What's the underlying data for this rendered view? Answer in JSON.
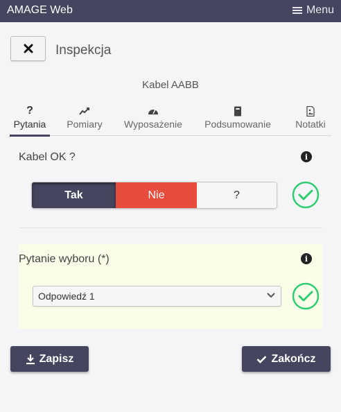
{
  "app": {
    "title": "AMAGE Web",
    "menu_label": "Menu"
  },
  "header": {
    "close_icon": "close-icon",
    "title": "Inspekcja"
  },
  "subject": "Kabel AABB",
  "tabs": [
    {
      "label": "Pytania",
      "icon": "question-icon",
      "active": true
    },
    {
      "label": "Pomiary",
      "icon": "line-chart-icon",
      "active": false
    },
    {
      "label": "Wyposażenie",
      "icon": "gauge-icon",
      "active": false
    },
    {
      "label": "Podsumowanie",
      "icon": "notebook-icon",
      "active": false
    },
    {
      "label": "Notatki",
      "icon": "document-image-icon",
      "active": false
    }
  ],
  "question1": {
    "label": "Kabel OK ?",
    "options": [
      "Tak",
      "Nie",
      "?"
    ],
    "selected": "Tak",
    "status_icon": "check-circle-icon"
  },
  "question2": {
    "label": "Pytanie wyboru (*)",
    "selected_value": "Odpowiedź 1",
    "status_icon": "check-circle-icon"
  },
  "actions": {
    "save_label": "Zapisz",
    "finish_label": "Zakończ"
  },
  "colors": {
    "primary": "#454560",
    "danger": "#e84c3d",
    "success": "#2ecc71",
    "highlight_bg": "#fcfde9"
  }
}
